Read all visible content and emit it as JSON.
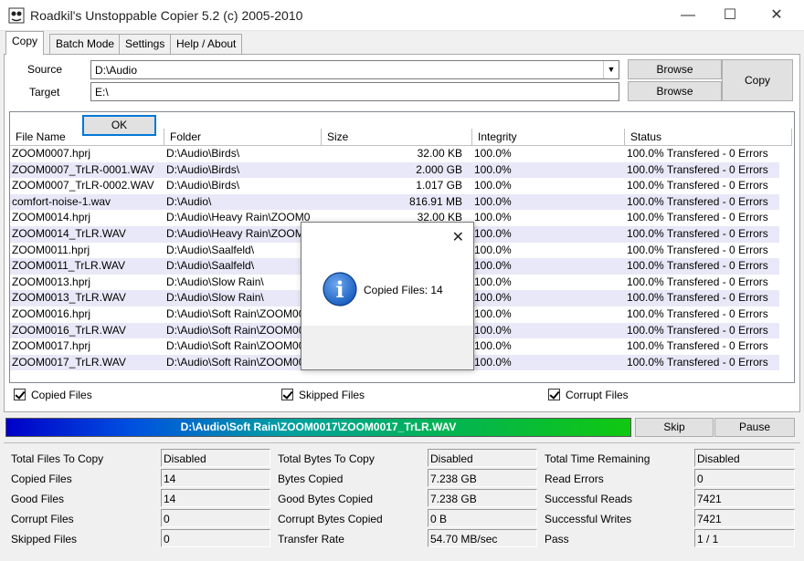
{
  "window": {
    "title": "Roadkil's Unstoppable Copier 5.2 (c) 2005-2010",
    "min_glyph": "—",
    "max_glyph": "☐",
    "close_glyph": "✕"
  },
  "tabs": [
    "Copy",
    "Batch Mode",
    "Settings",
    "Help / About"
  ],
  "paths": {
    "source_label": "Source",
    "source_value": "D:\\Audio",
    "target_label": "Target",
    "target_value": "E:\\",
    "browse_label": "Browse",
    "copy_label": "Copy"
  },
  "file_list": {
    "columns": [
      "File Name",
      "Folder",
      "Size",
      "Integrity",
      "Status"
    ],
    "rows": [
      {
        "name": "ZOOM0007.hprj",
        "folder": "D:\\Audio\\Birds\\",
        "size": "32.00 KB",
        "integrity": "100.0%",
        "status": "100.0% Transfered - 0 Errors"
      },
      {
        "name": "ZOOM0007_TrLR-0001.WAV",
        "folder": "D:\\Audio\\Birds\\",
        "size": "2.000 GB",
        "integrity": "100.0%",
        "status": "100.0% Transfered - 0 Errors"
      },
      {
        "name": "ZOOM0007_TrLR-0002.WAV",
        "folder": "D:\\Audio\\Birds\\",
        "size": "1.017 GB",
        "integrity": "100.0%",
        "status": "100.0% Transfered - 0 Errors"
      },
      {
        "name": "comfort-noise-1.wav",
        "folder": "D:\\Audio\\",
        "size": "816.91 MB",
        "integrity": "100.0%",
        "status": "100.0% Transfered - 0 Errors"
      },
      {
        "name": "ZOOM0014.hprj",
        "folder": "D:\\Audio\\Heavy Rain\\ZOOM0",
        "size": "32.00 KB",
        "integrity": "100.0%",
        "status": "100.0% Transfered - 0 Errors"
      },
      {
        "name": "ZOOM0014_TrLR.WAV",
        "folder": "D:\\Audio\\Heavy Rain\\ZOOM",
        "size": "",
        "integrity": "100.0%",
        "status": "100.0% Transfered - 0 Errors"
      },
      {
        "name": "ZOOM0011.hprj",
        "folder": "D:\\Audio\\Saalfeld\\",
        "size": "",
        "integrity": "100.0%",
        "status": "100.0% Transfered - 0 Errors"
      },
      {
        "name": "ZOOM0011_TrLR.WAV",
        "folder": "D:\\Audio\\Saalfeld\\",
        "size": "",
        "integrity": "100.0%",
        "status": "100.0% Transfered - 0 Errors"
      },
      {
        "name": "ZOOM0013.hprj",
        "folder": "D:\\Audio\\Slow Rain\\",
        "size": "",
        "integrity": "100.0%",
        "status": "100.0% Transfered - 0 Errors"
      },
      {
        "name": "ZOOM0013_TrLR.WAV",
        "folder": "D:\\Audio\\Slow Rain\\",
        "size": "",
        "integrity": "100.0%",
        "status": "100.0% Transfered - 0 Errors"
      },
      {
        "name": "ZOOM0016.hprj",
        "folder": "D:\\Audio\\Soft Rain\\ZOOM00",
        "size": "",
        "integrity": "100.0%",
        "status": "100.0% Transfered - 0 Errors"
      },
      {
        "name": "ZOOM0016_TrLR.WAV",
        "folder": "D:\\Audio\\Soft Rain\\ZOOM00",
        "size": "",
        "integrity": "100.0%",
        "status": "100.0% Transfered - 0 Errors"
      },
      {
        "name": "ZOOM0017.hprj",
        "folder": "D:\\Audio\\Soft Rain\\ZOOM00",
        "size": "",
        "integrity": "100.0%",
        "status": "100.0% Transfered - 0 Errors"
      },
      {
        "name": "ZOOM0017_TrLR.WAV",
        "folder": "D:\\Audio\\Soft Rain\\ZOOM00",
        "size": "",
        "integrity": "100.0%",
        "status": "100.0% Transfered - 0 Errors"
      }
    ]
  },
  "filters": {
    "copied": "Copied Files",
    "skipped": "Skipped Files",
    "corrupt": "Corrupt Files"
  },
  "progress": {
    "current_file": "D:\\Audio\\Soft Rain\\ZOOM0017\\ZOOM0017_TrLR.WAV",
    "skip_label": "Skip",
    "pause_label": "Pause"
  },
  "stats": [
    [
      {
        "label": "Total Files To Copy",
        "value": "Disabled"
      },
      {
        "label": "Copied Files",
        "value": "14"
      },
      {
        "label": "Good Files",
        "value": "14"
      },
      {
        "label": "Corrupt Files",
        "value": "0"
      },
      {
        "label": "Skipped Files",
        "value": "0"
      }
    ],
    [
      {
        "label": "Total Bytes To Copy",
        "value": "Disabled"
      },
      {
        "label": "Bytes Copied",
        "value": "7.238 GB"
      },
      {
        "label": "Good Bytes Copied",
        "value": "7.238 GB"
      },
      {
        "label": "Corrupt Bytes Copied",
        "value": "0 B"
      },
      {
        "label": "Transfer Rate",
        "value": "54.70 MB/sec"
      }
    ],
    [
      {
        "label": "Total Time Remaining",
        "value": "Disabled"
      },
      {
        "label": "Read Errors",
        "value": "0"
      },
      {
        "label": "Successful Reads",
        "value": "7421"
      },
      {
        "label": "Successful Writes",
        "value": "7421"
      },
      {
        "label": "Pass",
        "value": "1 / 1"
      }
    ]
  ],
  "dialog": {
    "message": "Copied Files: 14",
    "ok_label": "OK",
    "close_glyph": "✕",
    "icon_glyph": "i"
  },
  "colors": {
    "row_alt": "#e8e8f8",
    "progress_start": "#0000c8",
    "progress_end": "#10c810",
    "info_icon": "#1a5fc0"
  }
}
